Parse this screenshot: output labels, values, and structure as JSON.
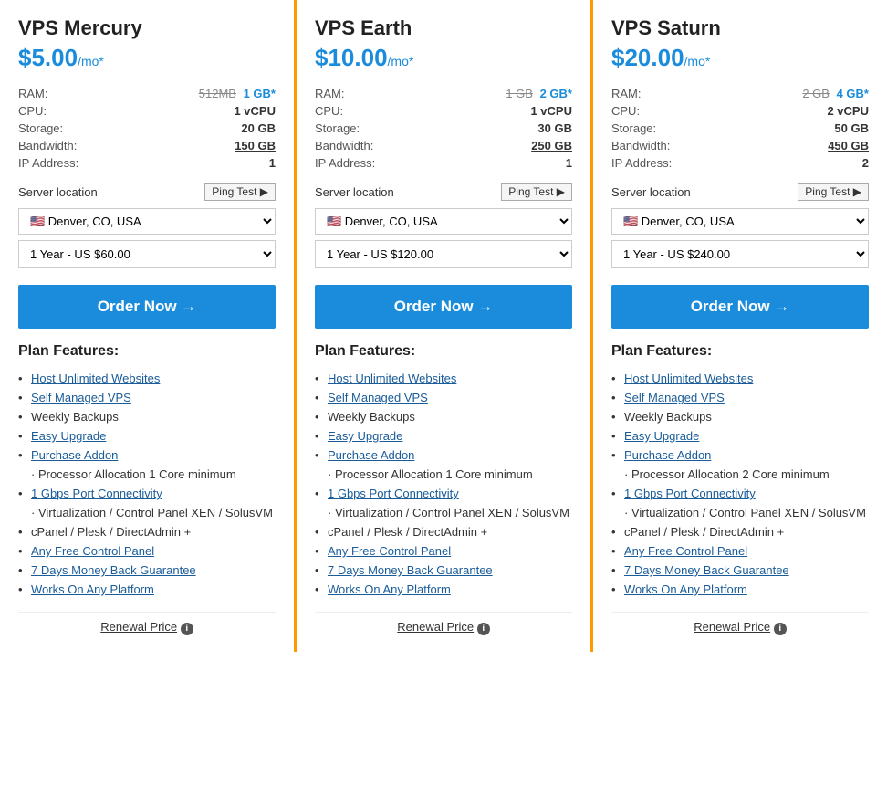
{
  "nav": {
    "left_arrow": "‹",
    "right_arrow": "›"
  },
  "plans": [
    {
      "id": "mercury",
      "name": "VPS Mercury",
      "price": "$5.00",
      "per_mo": "/mo*",
      "specs": {
        "ram_old": "512MB",
        "ram_new": "1 GB*",
        "cpu": "1 vCPU",
        "storage": "20 GB",
        "bandwidth": "150 GB",
        "ip_address": "1"
      },
      "server_location_label": "Server location",
      "ping_test": "Ping Test ▶",
      "location": "Denver, CO, USA",
      "billing": "1 Year - US $60.00",
      "order_btn": "Order Now →",
      "features_title": "Plan Features:",
      "features": [
        {
          "text": "Host Unlimited Websites",
          "link": true
        },
        {
          "text": "Self Managed VPS",
          "link": true
        },
        {
          "text": "Weekly Backups",
          "link": false
        },
        {
          "text": "Easy Upgrade",
          "link": true
        },
        {
          "text": "Purchase Addon",
          "link": true
        },
        {
          "text": "Processor Allocation 1 Core minimum",
          "link": false,
          "no_bullet": true
        },
        {
          "text": "1 Gbps Port Connectivity",
          "link": true
        },
        {
          "text": "Virtualization / Control Panel XEN / SolusVM",
          "link": false,
          "no_bullet": true
        },
        {
          "text": "cPanel / Plesk / DirectAdmin +",
          "link": false
        },
        {
          "text": "Any Free Control Panel",
          "link": true
        },
        {
          "text": "7 Days Money Back Guarantee",
          "link": true
        },
        {
          "text": "Works On Any Platform",
          "link": true
        }
      ],
      "renewal_price": "Renewal Price"
    },
    {
      "id": "earth",
      "name": "VPS Earth",
      "price": "$10.00",
      "per_mo": "/mo*",
      "specs": {
        "ram_old": "1 GB",
        "ram_new": "2 GB*",
        "cpu": "1 vCPU",
        "storage": "30 GB",
        "bandwidth": "250 GB",
        "ip_address": "1"
      },
      "server_location_label": "Server location",
      "ping_test": "Ping Test ▶",
      "location": "Denver, CO, USA",
      "billing": "1 Year - US $120.00",
      "order_btn": "Order Now →",
      "features_title": "Plan Features:",
      "features": [
        {
          "text": "Host Unlimited Websites",
          "link": true
        },
        {
          "text": "Self Managed VPS",
          "link": true
        },
        {
          "text": "Weekly Backups",
          "link": false
        },
        {
          "text": "Easy Upgrade",
          "link": true
        },
        {
          "text": "Purchase Addon",
          "link": true
        },
        {
          "text": "Processor Allocation 1 Core minimum",
          "link": false,
          "no_bullet": true
        },
        {
          "text": "1 Gbps Port Connectivity",
          "link": true
        },
        {
          "text": "Virtualization / Control Panel XEN / SolusVM",
          "link": false,
          "no_bullet": true
        },
        {
          "text": "cPanel / Plesk / DirectAdmin +",
          "link": false
        },
        {
          "text": "Any Free Control Panel",
          "link": true
        },
        {
          "text": "7 Days Money Back Guarantee",
          "link": true
        },
        {
          "text": "Works On Any Platform",
          "link": true
        }
      ],
      "renewal_price": "Renewal Price"
    },
    {
      "id": "saturn",
      "name": "VPS Saturn",
      "price": "$20.00",
      "per_mo": "/mo*",
      "specs": {
        "ram_old": "2 GB",
        "ram_new": "4 GB*",
        "cpu": "2 vCPU",
        "storage": "50 GB",
        "bandwidth": "450 GB",
        "ip_address": "2"
      },
      "server_location_label": "Server location",
      "ping_test": "Ping Test ▶",
      "location": "Denver, CO, USA",
      "billing": "1 Year - US $240.00",
      "order_btn": "Order Now →",
      "features_title": "Plan Features:",
      "features": [
        {
          "text": "Host Unlimited Websites",
          "link": true
        },
        {
          "text": "Self Managed VPS",
          "link": true
        },
        {
          "text": "Weekly Backups",
          "link": false
        },
        {
          "text": "Easy Upgrade",
          "link": true
        },
        {
          "text": "Purchase Addon",
          "link": true
        },
        {
          "text": "Processor Allocation 2 Core minimum",
          "link": false,
          "no_bullet": true
        },
        {
          "text": "1 Gbps Port Connectivity",
          "link": true
        },
        {
          "text": "Virtualization / Control Panel XEN / SolusVM",
          "link": false,
          "no_bullet": true
        },
        {
          "text": "cPanel / Plesk / DirectAdmin +",
          "link": false
        },
        {
          "text": "Any Free Control Panel",
          "link": true
        },
        {
          "text": "7 Days Money Back Guarantee",
          "link": true
        },
        {
          "text": "Works On Any Platform",
          "link": true
        }
      ],
      "renewal_price": "Renewal Price"
    }
  ]
}
